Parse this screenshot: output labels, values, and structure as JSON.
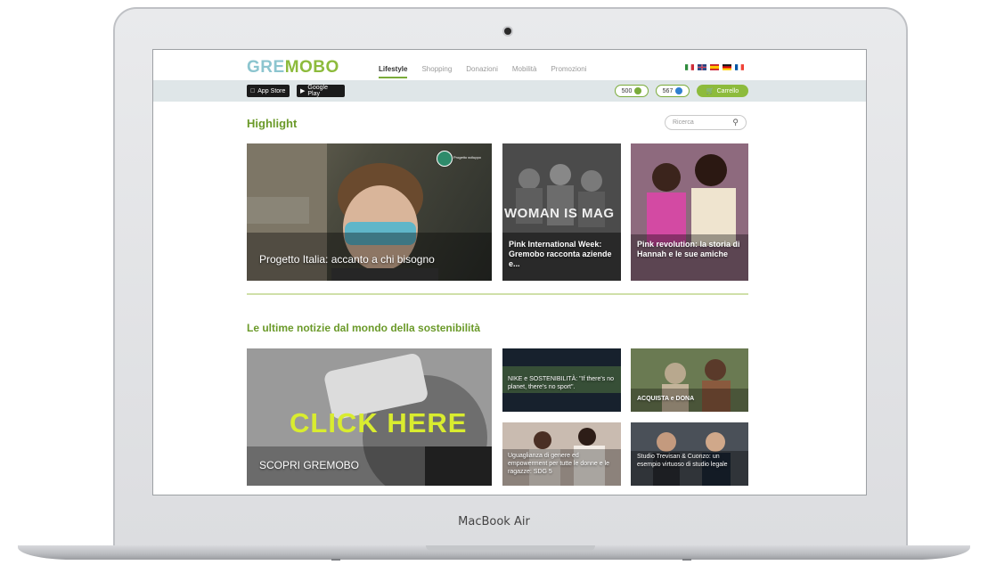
{
  "device": {
    "label": "MacBook Air"
  },
  "site": {
    "logo": {
      "part1": "GRE",
      "part2": "MOBO"
    },
    "tabs": [
      {
        "label": "Lifestyle",
        "active": true
      },
      {
        "label": "Shopping",
        "active": false
      },
      {
        "label": "Donazioni",
        "active": false
      },
      {
        "label": "Mobilità",
        "active": false
      },
      {
        "label": "Promozioni",
        "active": false
      }
    ],
    "flags": [
      "it",
      "gb",
      "es",
      "de",
      "fr"
    ]
  },
  "toolbar": {
    "app_store": "App Store",
    "google_play": "Google Play",
    "counter1": "500",
    "counter2": "567",
    "cart_label": "Carrello"
  },
  "highlight": {
    "title": "Highlight",
    "search_placeholder": "Ricerca",
    "cards": [
      {
        "caption": "Progetto Italia: accanto a chi bisogno",
        "tag": "Progetto sviluppo"
      },
      {
        "caption": "Pink International Week: Gremobo racconta aziende e...",
        "overlay": "WOMAN IS MAG"
      },
      {
        "caption": "Pink revolution: la storia di Hannah e le sue amiche"
      }
    ]
  },
  "news": {
    "title": "Le ultime notizie dal mondo della sostenibilità",
    "big": {
      "overlay": "CLICK HERE",
      "caption": "SCOPRI GREMOBO"
    },
    "cards": [
      {
        "caption": "NIKE e SOSTENIBILITÀ: \"If there's no planet, there's no sport\"."
      },
      {
        "caption": "ACQUISTA e DONA"
      },
      {
        "caption": "Uguaglianza di genere ed empowerment per tutte le donne e le ragazze: SDG 5"
      },
      {
        "caption": "Studio Trevisan & Cuonzo: un esempio virtuoso di studio legale"
      }
    ]
  },
  "colors": {
    "brand_green": "#8dbb3c",
    "brand_blue": "#8cc5cf",
    "heading_green": "#6b9a2a",
    "toolbar_bg": "#dfe6e8"
  }
}
